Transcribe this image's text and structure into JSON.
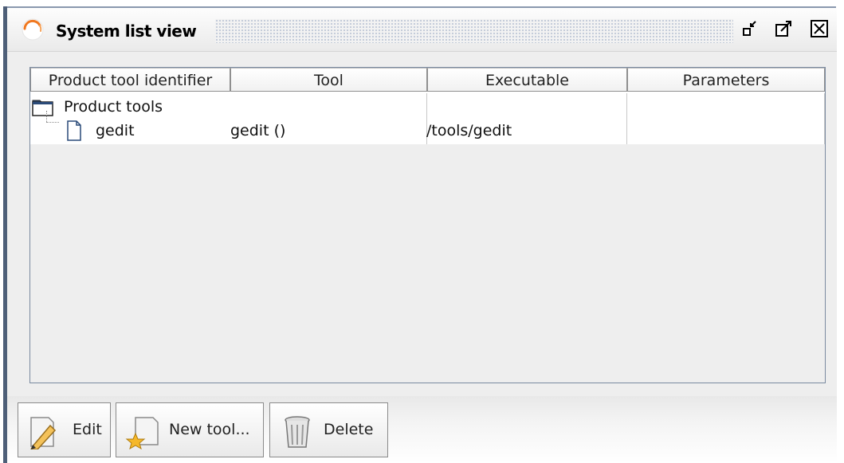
{
  "window": {
    "title": "System list view",
    "icon": "orange-spinner-icon",
    "controls": [
      "minimize-icon",
      "maximize-icon",
      "close-icon"
    ]
  },
  "table": {
    "columns": [
      "Product tool identifier",
      "Tool",
      "Executable",
      "Parameters"
    ],
    "rows": [
      {
        "identifier": "Product tools",
        "tool": "",
        "executable": "",
        "parameters": "",
        "icon": "folder-icon",
        "level": 0
      },
      {
        "identifier": "gedit",
        "tool": "gedit ()",
        "executable": "/tools/gedit",
        "parameters": "",
        "icon": "document-icon",
        "level": 1
      }
    ]
  },
  "toolbar": {
    "edit_label": "Edit",
    "new_tool_label": "New tool...",
    "delete_label": "Delete"
  },
  "colors": {
    "accent": "#f07820",
    "border": "#7a8aa0",
    "window_edge": "#4e5f78"
  }
}
